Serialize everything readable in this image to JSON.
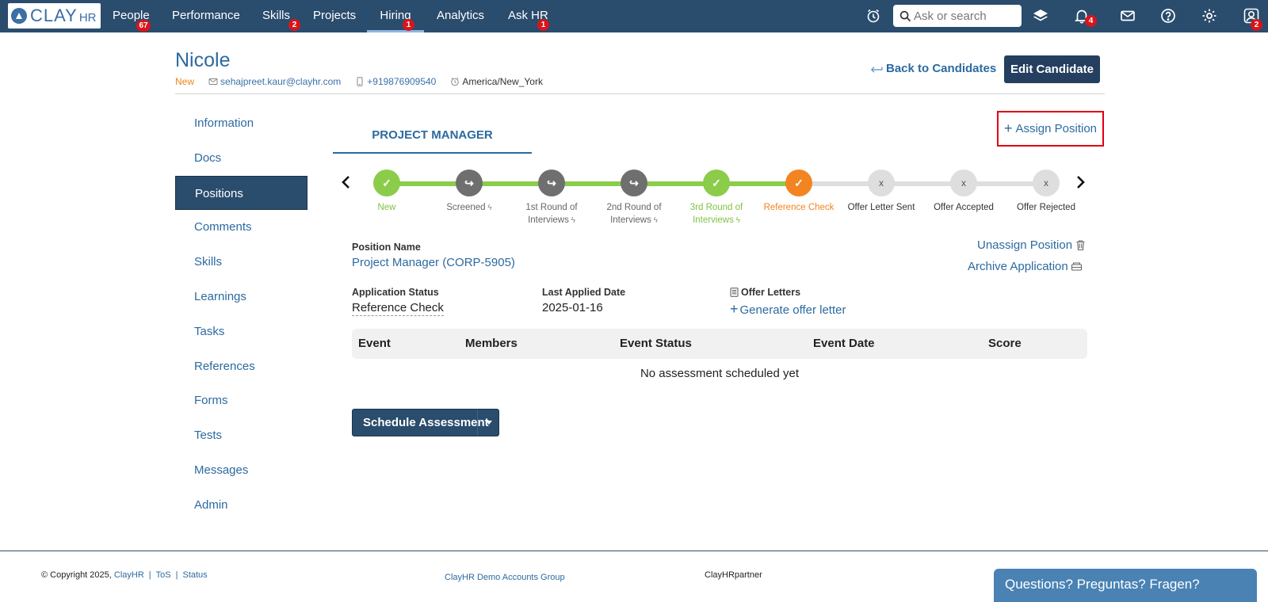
{
  "nav": {
    "logo_text": "CLAY",
    "logo_suffix": "HR",
    "items": [
      {
        "label": "People",
        "badge": "67"
      },
      {
        "label": "Performance",
        "badge": ""
      },
      {
        "label": "Skills",
        "badge": "2"
      },
      {
        "label": "Projects",
        "badge": ""
      },
      {
        "label": "Hiring",
        "badge": "1"
      },
      {
        "label": "Analytics",
        "badge": ""
      },
      {
        "label": "Ask HR",
        "badge": "1"
      }
    ],
    "active": "Hiring",
    "search_placeholder": "Ask or search",
    "notifications_badge": "4",
    "profile_badge": "2",
    "icons": [
      "alarm-clock-icon",
      "search-icon",
      "layers-icon",
      "bell-icon",
      "mail-icon",
      "help-icon",
      "gear-icon",
      "user-icon"
    ]
  },
  "candidate": {
    "name": "Nicole",
    "status": "New",
    "email": "sehajpreet.kaur@clayhr.com",
    "phone": "+919876909540",
    "timezone": "America/New_York"
  },
  "header": {
    "back_label": "Back to Candidates",
    "edit_label": "Edit Candidate"
  },
  "sidebar": {
    "items": [
      "Information",
      "Docs",
      "Positions",
      "Comments",
      "Skills",
      "Learnings",
      "Tasks",
      "References",
      "Forms",
      "Tests",
      "Messages",
      "Admin"
    ],
    "active": "Positions"
  },
  "position": {
    "tab_label": "PROJECT MANAGER",
    "assign_label": "Assign Position",
    "stages": [
      {
        "label": "New",
        "state": "done",
        "mark": "✓",
        "bolt": false
      },
      {
        "label": "Screened",
        "state": "skipped",
        "mark": "↪",
        "bolt": true
      },
      {
        "label": "1st Round of Interviews",
        "state": "skipped",
        "mark": "↪",
        "bolt": true
      },
      {
        "label": "2nd Round of Interviews",
        "state": "skipped",
        "mark": "↪",
        "bolt": true
      },
      {
        "label": "3rd Round of Interviews",
        "state": "done",
        "mark": "✓",
        "bolt": true
      },
      {
        "label": "Reference Check",
        "state": "current",
        "mark": "✓",
        "bolt": false
      },
      {
        "label": "Offer Letter Sent",
        "state": "todo",
        "mark": "x",
        "bolt": false
      },
      {
        "label": "Offer Accepted",
        "state": "todo",
        "mark": "x",
        "bolt": false
      },
      {
        "label": "Offer Rejected",
        "state": "todo",
        "mark": "x",
        "bolt": false
      }
    ],
    "colors": {
      "done": "#8ccc4b",
      "skipped": "#6f6f6f",
      "current": "#f28422",
      "todo": "#dedede"
    },
    "name_label": "Position Name",
    "name_value": "Project Manager (CORP-5905)",
    "unassign_label": "Unassign Position",
    "archive_label": "Archive Application",
    "status_label": "Application Status",
    "status_value": "Reference Check",
    "applied_label": "Last Applied Date",
    "applied_value": "2025-01-16",
    "offer_label": "Offer Letters",
    "generate_label": "Generate offer letter",
    "table_headers": [
      "Event",
      "Members",
      "Event Status",
      "Event Date",
      "Score"
    ],
    "table_empty": "No assessment scheduled yet",
    "schedule_label": "Schedule Assessment"
  },
  "footer": {
    "copyright": "© Copyright 2025,",
    "brand_link": "ClayHR",
    "tos": "ToS",
    "status": "Status",
    "group": "ClayHR Demo Accounts Group",
    "partner": "ClayHRpartner",
    "chat": "Questions? Preguntas? Fragen?"
  }
}
